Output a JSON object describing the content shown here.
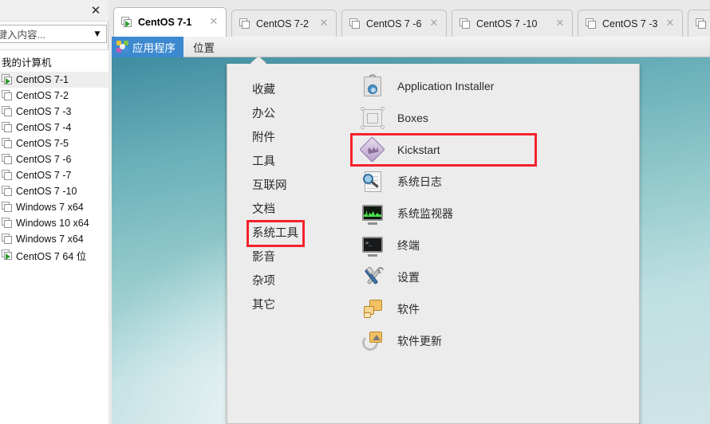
{
  "library": {
    "close_label": "✕",
    "search_value": "在此处键入内容...",
    "dropdown_icon": "▼",
    "group_label": "我的计算机",
    "items": [
      {
        "label": "CentOS 7-1",
        "running": true,
        "selected": true
      },
      {
        "label": "CentOS 7-2",
        "running": false,
        "selected": false
      },
      {
        "label": "CentOS 7 -3",
        "running": false,
        "selected": false
      },
      {
        "label": "CentOS 7 -4",
        "running": false,
        "selected": false
      },
      {
        "label": "CentOS 7-5",
        "running": false,
        "selected": false
      },
      {
        "label": "CentOS 7 -6",
        "running": false,
        "selected": false
      },
      {
        "label": "CentOS 7 -7",
        "running": false,
        "selected": false
      },
      {
        "label": "CentOS 7 -10",
        "running": false,
        "selected": false
      },
      {
        "label": "Windows 7 x64",
        "running": false,
        "selected": false
      },
      {
        "label": "Windows 10 x64",
        "running": false,
        "selected": false
      },
      {
        "label": "Windows 7 x64",
        "running": false,
        "selected": false
      },
      {
        "label": "CentOS 7 64 位",
        "running": true,
        "selected": false
      }
    ]
  },
  "tabs": [
    {
      "label": "CentOS 7-1",
      "active": true,
      "running": true,
      "close": "✕"
    },
    {
      "label": "CentOS 7-2",
      "active": false,
      "running": false,
      "close": "✕"
    },
    {
      "label": "CentOS 7 -6",
      "active": false,
      "running": false,
      "close": "✕"
    },
    {
      "label": "CentOS 7 -10",
      "active": false,
      "running": false,
      "close": "✕"
    },
    {
      "label": "CentOS 7 -3",
      "active": false,
      "running": false,
      "close": "✕"
    }
  ],
  "gnome_bar": {
    "applications_label": "应用程序",
    "applications_icon": "app-grid-icon",
    "places_label": "位置",
    "accent_color": "#3c89d0"
  },
  "app_menu": {
    "highlight_color": "#f5222d",
    "categories": [
      {
        "label": "收藏",
        "highlighted": false
      },
      {
        "label": "办公",
        "highlighted": false
      },
      {
        "label": "附件",
        "highlighted": false
      },
      {
        "label": "工具",
        "highlighted": false
      },
      {
        "label": "互联网",
        "highlighted": false
      },
      {
        "label": "文档",
        "highlighted": false
      },
      {
        "label": "系统工具",
        "highlighted": true
      },
      {
        "label": "影音",
        "highlighted": false
      },
      {
        "label": "杂项",
        "highlighted": false
      },
      {
        "label": "其它",
        "highlighted": false
      }
    ],
    "applications": [
      {
        "label": "Application Installer",
        "icon": "app-installer-icon",
        "highlighted": false
      },
      {
        "label": "Boxes",
        "icon": "boxes-icon",
        "highlighted": false
      },
      {
        "label": "Kickstart",
        "icon": "kickstart-icon",
        "highlighted": true
      },
      {
        "label": "系统日志",
        "icon": "system-log-icon",
        "highlighted": false
      },
      {
        "label": "系统监视器",
        "icon": "system-monitor-icon",
        "highlighted": false
      },
      {
        "label": "终端",
        "icon": "terminal-icon",
        "highlighted": false
      },
      {
        "label": "设置",
        "icon": "settings-icon",
        "highlighted": false
      },
      {
        "label": "软件",
        "icon": "software-icon",
        "highlighted": false
      },
      {
        "label": "软件更新",
        "icon": "software-update-icon",
        "highlighted": false
      }
    ]
  },
  "desktop": {
    "wallpaper_top_color": "#3f8ca0",
    "wallpaper_bottom_color": "#cfe4e6"
  }
}
